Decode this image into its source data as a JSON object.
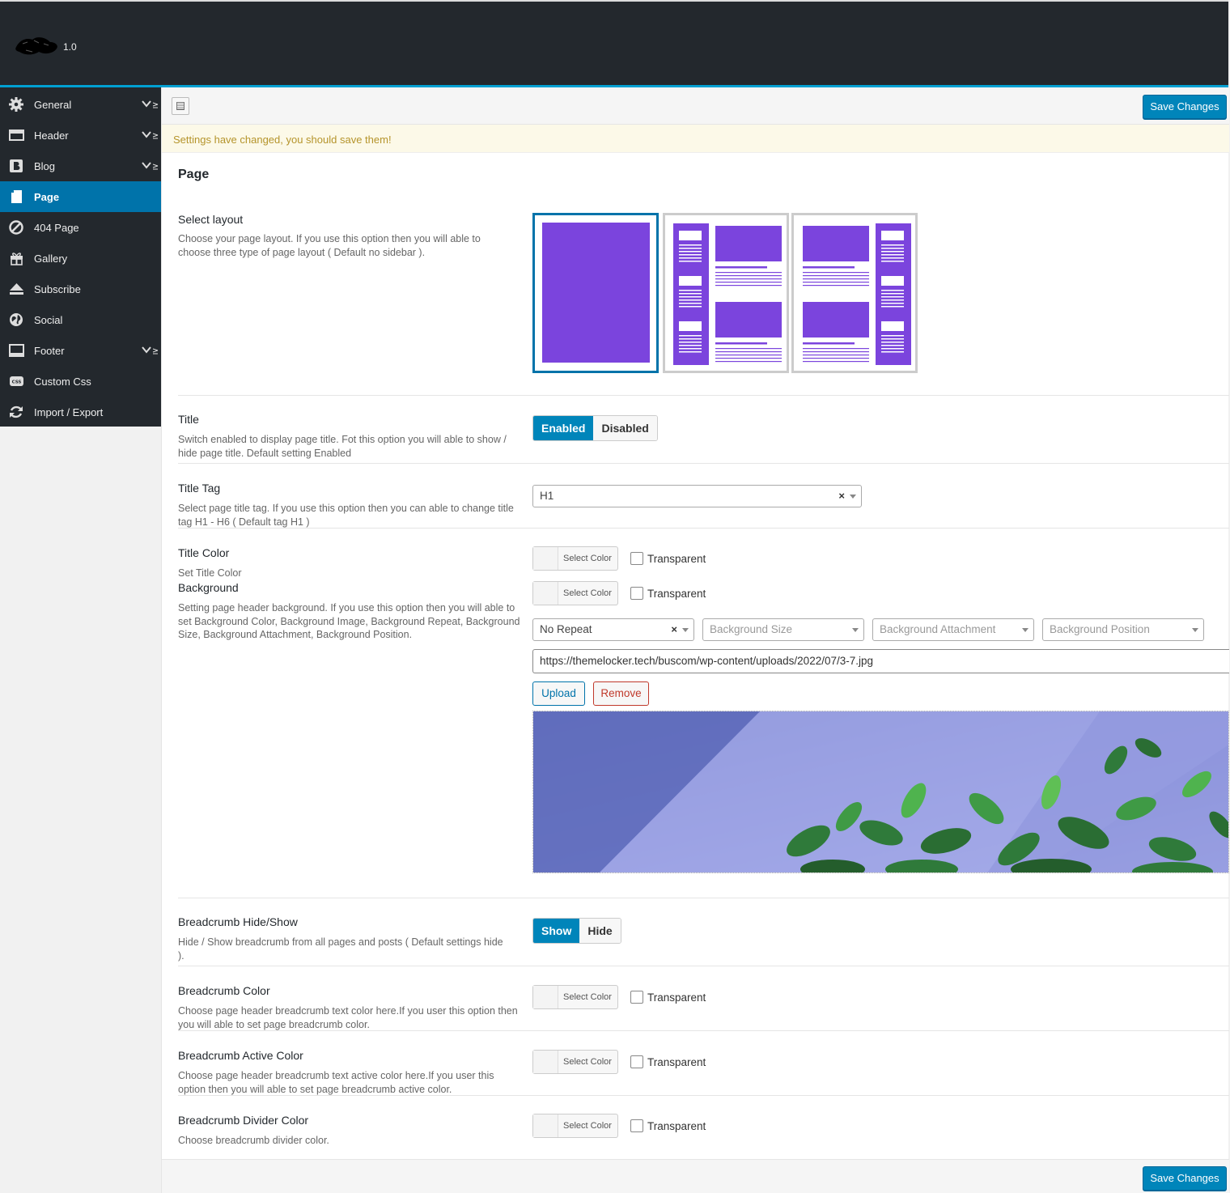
{
  "app": {
    "version": "1.0"
  },
  "sidebar": {
    "items": [
      {
        "label": "General",
        "icon": "gear-icon",
        "has_children": true
      },
      {
        "label": "Header",
        "icon": "header-icon",
        "has_children": true
      },
      {
        "label": "Blog",
        "icon": "blog-icon",
        "has_children": true
      },
      {
        "label": "Page",
        "icon": "page-icon",
        "has_children": false,
        "active": true
      },
      {
        "label": "404 Page",
        "icon": "ban-icon",
        "has_children": false
      },
      {
        "label": "Gallery",
        "icon": "gift-icon",
        "has_children": false
      },
      {
        "label": "Subscribe",
        "icon": "eject-icon",
        "has_children": false
      },
      {
        "label": "Social",
        "icon": "globe-icon",
        "has_children": false
      },
      {
        "label": "Footer",
        "icon": "footer-icon",
        "has_children": true
      },
      {
        "label": "Custom Css",
        "icon": "css-icon",
        "has_children": false
      },
      {
        "label": "Import / Export",
        "icon": "refresh-icon",
        "has_children": false
      }
    ]
  },
  "toolbar": {
    "save_label": "Save Changes"
  },
  "notice": "Settings have changed, you should save them!",
  "section": {
    "title": "Page"
  },
  "fields": {
    "layout": {
      "label": "Select layout",
      "desc": "Choose your page layout. If you use this option then you will able to choose three type of page layout ( Default no sidebar ).",
      "options": [
        "no-sidebar",
        "left-sidebar",
        "right-sidebar"
      ],
      "selected": "no-sidebar",
      "accent_color": "#7b44dd"
    },
    "title": {
      "label": "Title",
      "desc": "Switch enabled to display page title. Fot this option you will able to show / hide page title. Default setting Enabled",
      "on_label": "Enabled",
      "off_label": "Disabled",
      "value": "Enabled"
    },
    "title_tag": {
      "label": "Title Tag",
      "desc": "Select page title tag. If you use this option then you can able to change title tag H1 - H6 ( Default tag H1 )",
      "value": "H1",
      "clear": "×"
    },
    "title_color": {
      "label": "Title Color",
      "desc": "Set Title Color",
      "button": "Select Color",
      "transparent": "Transparent"
    },
    "background": {
      "label": "Background",
      "desc": "Setting page header background. If you use this option then you will able to set Background Color, Background Image, Background Repeat, Background Size, Background Attachment, Background Position.",
      "button": "Select Color",
      "transparent": "Transparent",
      "repeat": "No Repeat",
      "repeat_clear": "×",
      "size_placeholder": "Background Size",
      "attachment_placeholder": "Background Attachment",
      "position_placeholder": "Background Position",
      "url": "https://themelocker.tech/buscom/wp-content/uploads/2022/07/3-7.jpg",
      "upload": "Upload",
      "remove": "Remove"
    },
    "breadcrumb": {
      "label": "Breadcrumb Hide/Show",
      "desc": "Hide / Show breadcrumb from all pages and posts ( Default settings hide ).",
      "on_label": "Show",
      "off_label": "Hide",
      "value": "Show"
    },
    "breadcrumb_color": {
      "label": "Breadcrumb Color",
      "desc": "Choose page header breadcrumb text color here.If you user this option then you will able to set page breadcrumb color.",
      "button": "Select Color",
      "transparent": "Transparent"
    },
    "breadcrumb_active_color": {
      "label": "Breadcrumb Active Color",
      "desc": "Choose page header breadcrumb text active color here.If you user this option then you will able to set page breadcrumb active color.",
      "button": "Select Color",
      "transparent": "Transparent"
    },
    "breadcrumb_divider_color": {
      "label": "Breadcrumb Divider Color",
      "desc": "Choose breadcrumb divider color.",
      "button": "Select Color",
      "transparent": "Transparent"
    }
  },
  "colors": {
    "header_bg": "#23282d",
    "active_bg": "#0073aa",
    "primary_button": "#0085ba",
    "notice_text": "#b5942b"
  }
}
